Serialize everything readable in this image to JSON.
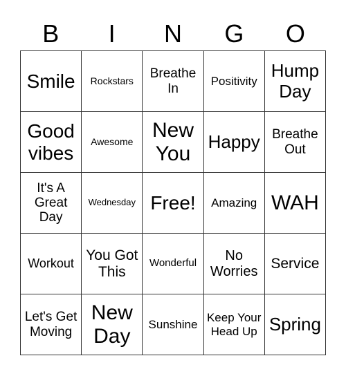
{
  "header": [
    "B",
    "I",
    "N",
    "G",
    "O"
  ],
  "cells": [
    [
      "Smile",
      "Rockstars",
      "Breathe In",
      "Positivity",
      "Hump Day"
    ],
    [
      "Good vibes",
      "Awesome",
      "New You",
      "Happy",
      "Breathe Out"
    ],
    [
      "It's A Great Day",
      "Wednesday",
      "Free!",
      "Amazing",
      "WAH"
    ],
    [
      "Workout",
      "You Got This",
      "Wonderful",
      "No Worries",
      "Service"
    ],
    [
      "Let's Get Moving",
      "New Day",
      "Sunshine",
      "Keep Your Head Up",
      "Spring"
    ]
  ]
}
